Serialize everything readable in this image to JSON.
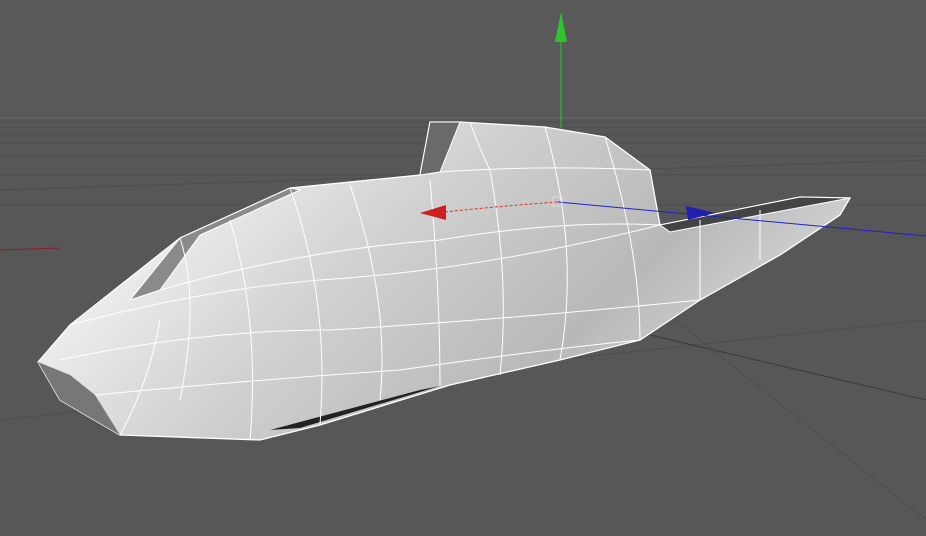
{
  "viewport": {
    "background_color": "#595959",
    "grid_color": "#4a4a4a",
    "mesh_color": "#c8c8c8",
    "axis_colors": {
      "x": "#cc1f1f",
      "y": "#22c022",
      "z": "#1f1fcc"
    }
  }
}
